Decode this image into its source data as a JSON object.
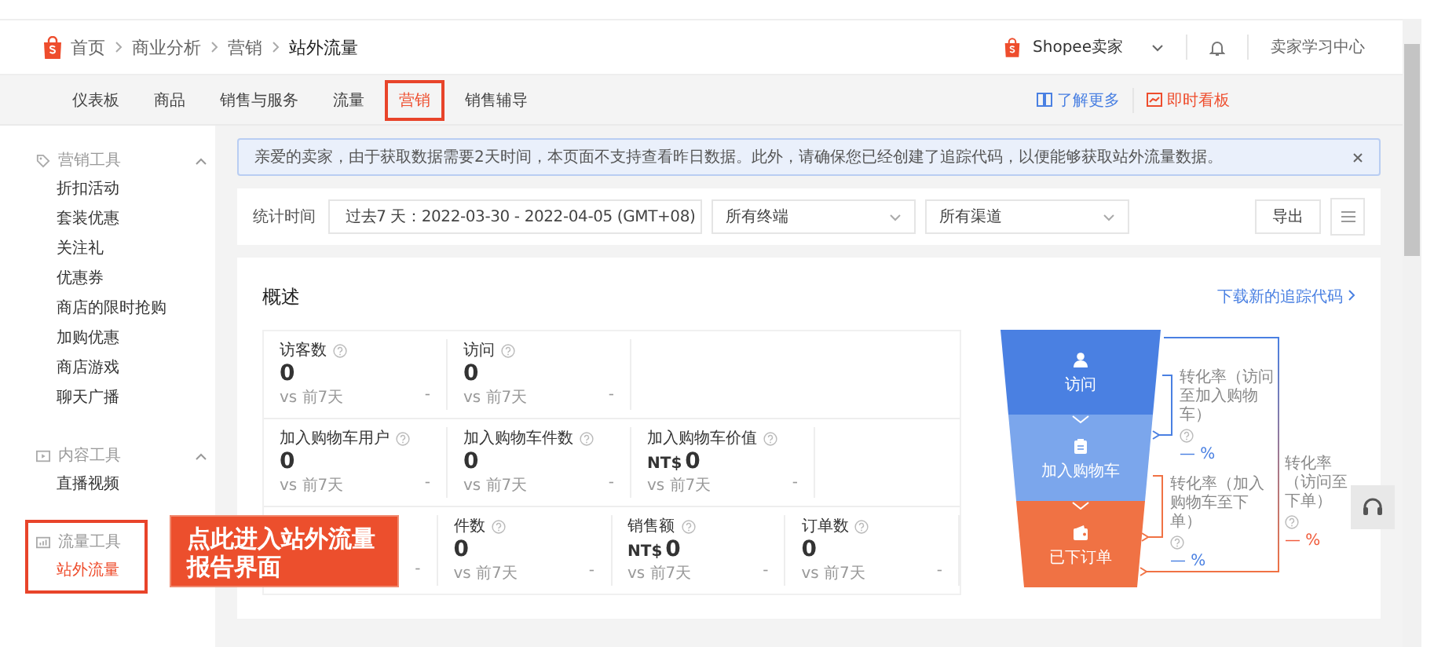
{
  "header": {
    "breadcrumb": [
      "首页",
      "商业分析",
      "营销",
      "站外流量"
    ],
    "shop_name": "Shopee卖家",
    "learning_center": "卖家学习中心"
  },
  "tabs": [
    {
      "label": "仪表板",
      "selected": false,
      "highlighted": false
    },
    {
      "label": "商品",
      "selected": false,
      "highlighted": false
    },
    {
      "label": "销售与服务",
      "selected": false,
      "highlighted": false
    },
    {
      "label": "流量",
      "selected": false,
      "highlighted": false
    },
    {
      "label": "营销",
      "selected": true,
      "highlighted": true
    },
    {
      "label": "销售辅导",
      "selected": false,
      "highlighted": false
    }
  ],
  "tab_links": [
    {
      "label": "了解更多",
      "kind": "book"
    },
    {
      "label": "即时看板",
      "kind": "board"
    }
  ],
  "sidebar": {
    "groups": [
      {
        "title": "营销工具",
        "kind": "tag",
        "expanded": true,
        "highlighted": false,
        "items": [
          {
            "label": "折扣活动",
            "selected": false
          },
          {
            "label": "套装优惠",
            "selected": false
          },
          {
            "label": "关注礼",
            "selected": false
          },
          {
            "label": "优惠券",
            "selected": false
          },
          {
            "label": "商店的限时抢购",
            "selected": false
          },
          {
            "label": "加购优惠",
            "selected": false
          },
          {
            "label": "商店游戏",
            "selected": false
          },
          {
            "label": "聊天广播",
            "selected": false
          }
        ]
      },
      {
        "title": "内容工具",
        "kind": "video",
        "expanded": true,
        "highlighted": false,
        "items": [
          {
            "label": "直播视频",
            "selected": false
          }
        ]
      },
      {
        "title": "流量工具",
        "kind": "chart",
        "highlighted": true,
        "items": [
          {
            "label": "站外流量",
            "selected": true
          }
        ]
      }
    ]
  },
  "notice": {
    "text": "亲爱的卖家，由于获取数据需要2天时间，本页面不支持查看昨日数据。此外，请确保您已经创建了追踪代码，以便能够获取站外流量数据。"
  },
  "filters": {
    "label": "统计时间",
    "date_range": "过去7 天：2022-03-30 - 2022-04-05 (GMT+08)",
    "dropdowns": [
      "所有终端",
      "所有渠道"
    ],
    "export_button": "导出"
  },
  "overview": {
    "title": "概述",
    "link": "下载新的追踪代码",
    "metric_rows": [
      [
        {
          "label": "访客数",
          "value": "0",
          "compare": "vs 前7天",
          "change": "-"
        },
        {
          "label": "访问",
          "value": "0",
          "compare": "vs 前7天",
          "change": "-"
        }
      ],
      [
        {
          "label": "加入购物车用户",
          "value": "0",
          "compare": "vs 前7天",
          "change": "-"
        },
        {
          "label": "加入购物车件数",
          "value": "0",
          "compare": "vs 前7天",
          "change": "-"
        },
        {
          "label": "加入购物车价值",
          "currency": "NT$",
          "value": "0",
          "compare": "vs 前7天",
          "change": "-"
        }
      ],
      [
        {
          "change": "-"
        },
        {
          "label": "件数",
          "value": "0",
          "compare": "vs 前7天",
          "change": "-"
        },
        {
          "label": "销售额",
          "currency": "NT$",
          "value": "0",
          "compare": "vs 前7天",
          "change": "-"
        },
        {
          "label": "订单数",
          "value": "0",
          "compare": "vs 前7天",
          "change": "-"
        }
      ]
    ],
    "funnel": [
      {
        "label": "访问",
        "kind": "visit",
        "color": "#4a80e2"
      },
      {
        "label": "加入购物车",
        "kind": "cart",
        "color": "#7ba6ec"
      },
      {
        "label": "已下订单",
        "kind": "order",
        "color": "#f07244"
      }
    ],
    "conversions": [
      {
        "label": "转化率（访问至加入购物车）",
        "value": "— %",
        "color": "#4a80e2"
      },
      {
        "label": "转化率（加入购物车至下单）",
        "value": "— %",
        "color": "#4a80e2"
      },
      {
        "label": "转化率（访问至下单）",
        "value": "— %",
        "color": "#f05a3a"
      }
    ]
  },
  "callout": {
    "text": "点此进入站外流量报告界面"
  }
}
